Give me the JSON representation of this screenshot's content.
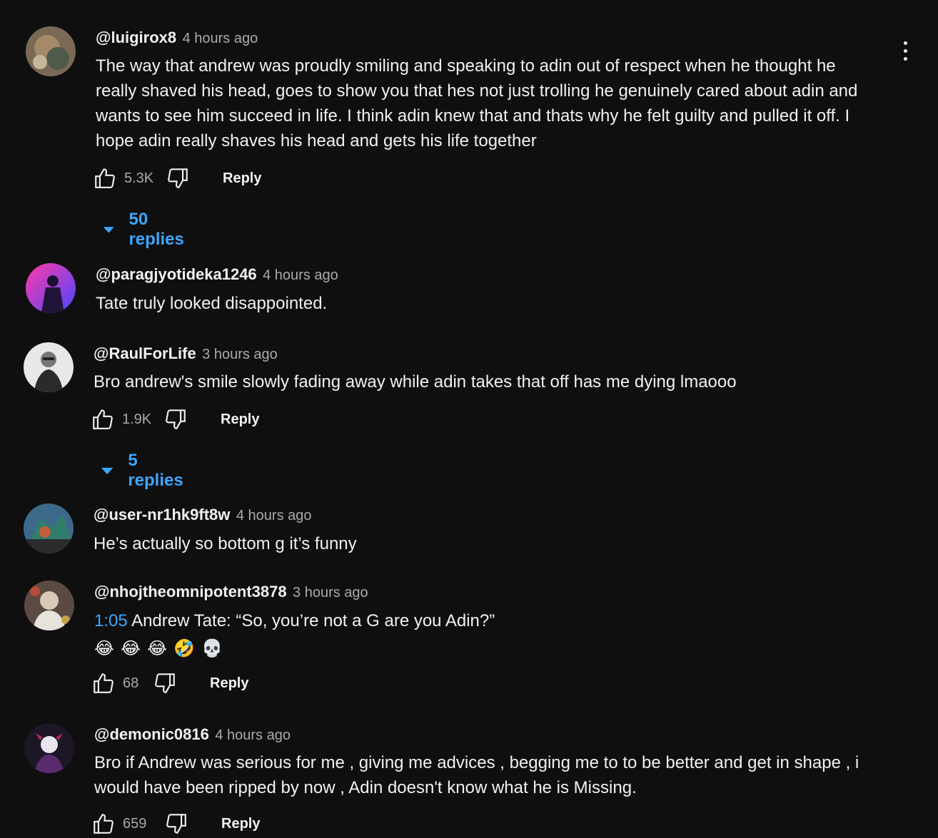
{
  "comments": [
    {
      "author": "@luigirox8",
      "time": "4 hours ago",
      "text": "The way that andrew was proudly smiling and speaking to adin out of respect when he thought he really shaved his head, goes to show you that hes not just trolling he genuinely cared about adin and wants to see him succeed in life. I think adin knew that and thats why he felt guilty and pulled it off. I hope adin really shaves his head and gets his life together",
      "likes": "5.3K",
      "reply_label": "Reply",
      "replies_label": "50 replies"
    },
    {
      "author": "@paragjyotideka1246",
      "time": "4 hours ago",
      "text": "Tate truly looked disappointed."
    },
    {
      "author": "@RaulForLife",
      "time": "3 hours ago",
      "text": "Bro andrew's smile slowly fading away while adin takes that off has me dying lmaooo",
      "likes": "1.9K",
      "reply_label": "Reply",
      "replies_label": "5 replies"
    },
    {
      "author": "@user-nr1hk9ft8w",
      "time": "4 hours ago",
      "text": "He’s actually so bottom g it’s funny"
    },
    {
      "author": "@nhojtheomnipotent3878",
      "time": "3 hours ago",
      "timestamp_link": "1:05",
      "text": " Andrew Tate: “So, you’re not a G are you Adin?”",
      "emojis": [
        "😂",
        "😂",
        "😂",
        "🤣",
        "💀"
      ],
      "likes": "68",
      "reply_label": "Reply"
    },
    {
      "author": "@demonic0816",
      "time": "4 hours ago",
      "text": "Bro if Andrew was serious for me , giving me advices , begging me to to be better and get in shape , i would have been ripped by now , Adin doesn't know what he is Missing.",
      "likes": "659",
      "reply_label": "Reply"
    }
  ],
  "icons": {
    "like": "thumbs-up-icon",
    "dislike": "thumbs-down-icon",
    "expand": "caret-down-icon",
    "menu": "more-vertical-icon"
  },
  "colors": {
    "background": "#0f0f0f",
    "link": "#3ea6ff",
    "secondary_text": "#aaaaaa"
  }
}
